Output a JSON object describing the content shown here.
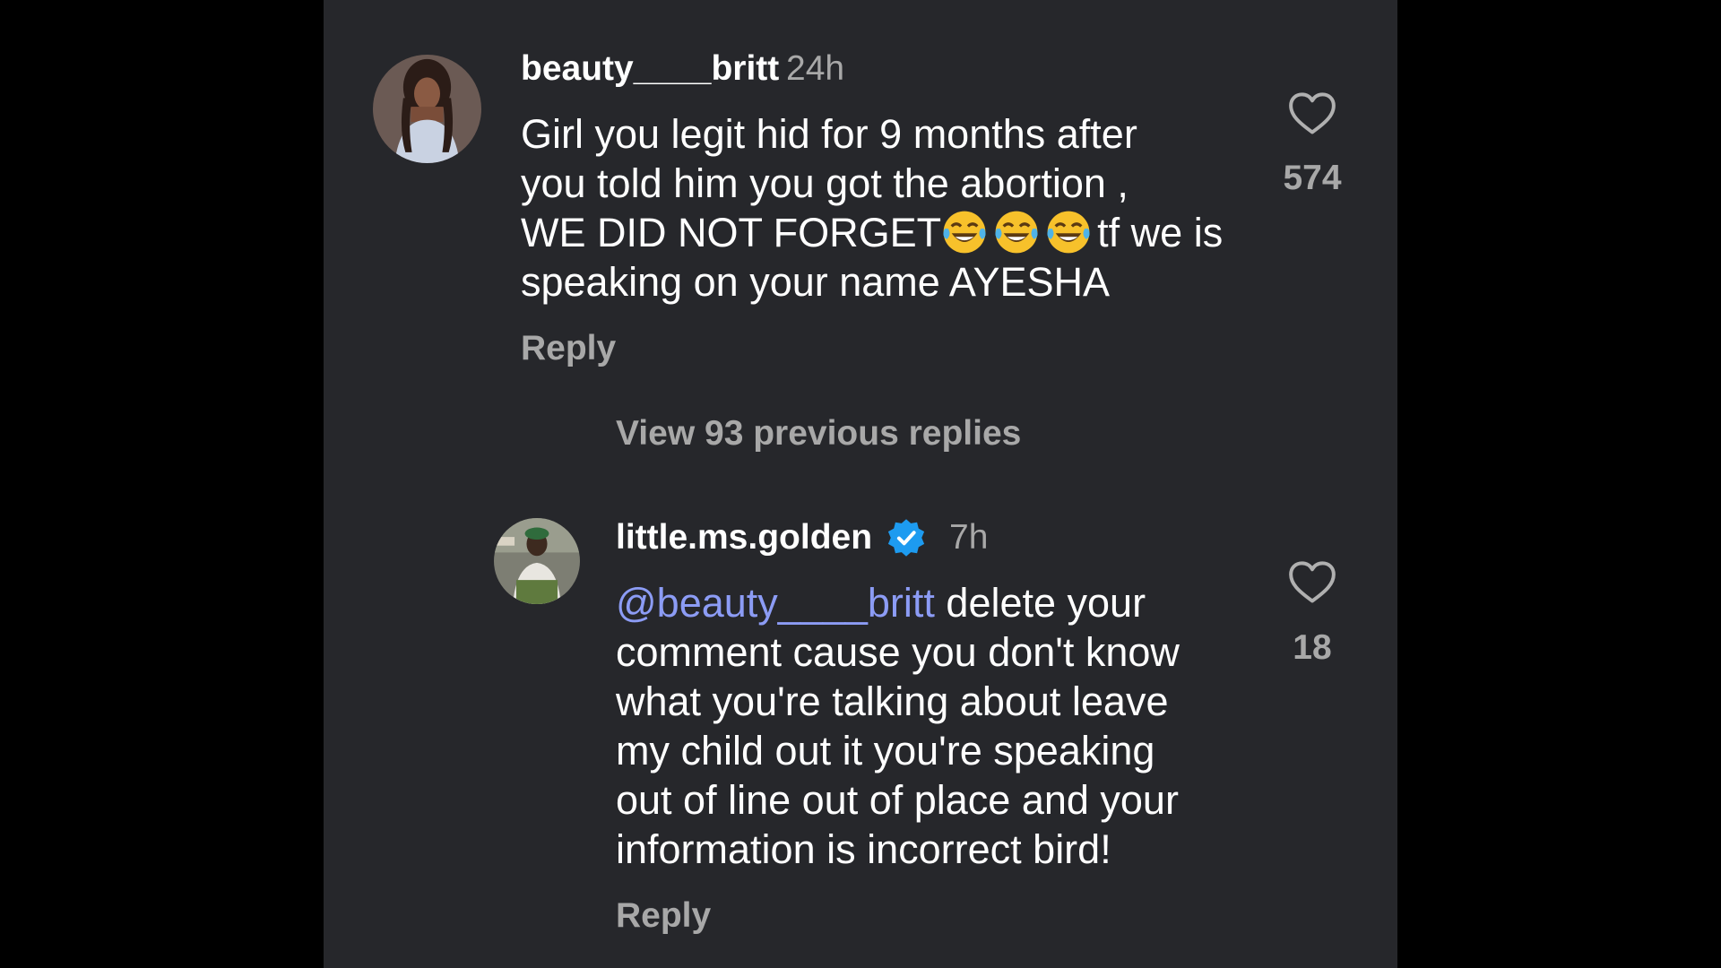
{
  "colors": {
    "panel_bg": "#26272b",
    "outer_bg": "#000000",
    "text": "#ffffff",
    "muted": "#a8a8a8",
    "mention": "#8c9cf5",
    "verified": "#1d9bf0"
  },
  "comment": {
    "username": "beauty____britt",
    "time": "24h",
    "text_line1": "Girl you legit hid for 9 months after",
    "text_line2": "you told him you got the abortion ,",
    "text_line3_a": "WE DID NOT FORGET",
    "emoji": "face-with-tears-of-joy",
    "text_line3_b": "tf we is",
    "text_line4": "speaking on your name AYESHA",
    "reply_label": "Reply",
    "likes": "574",
    "like_icon": "heart-outline-icon"
  },
  "view_replies": "View 93 previous replies",
  "reply": {
    "username": "little.ms.golden",
    "verified_icon": "verified-badge-icon",
    "time": "7h",
    "mention": "@beauty____britt",
    "text_line1_rest": " delete your",
    "text_line2": "comment cause you don't know",
    "text_line3": "what you're talking about leave",
    "text_line4": "my child out it you're speaking",
    "text_line5": "out of line out of place and your",
    "text_line6": "information is incorrect bird!",
    "reply_label": "Reply",
    "likes": "18",
    "like_icon": "heart-outline-icon"
  }
}
